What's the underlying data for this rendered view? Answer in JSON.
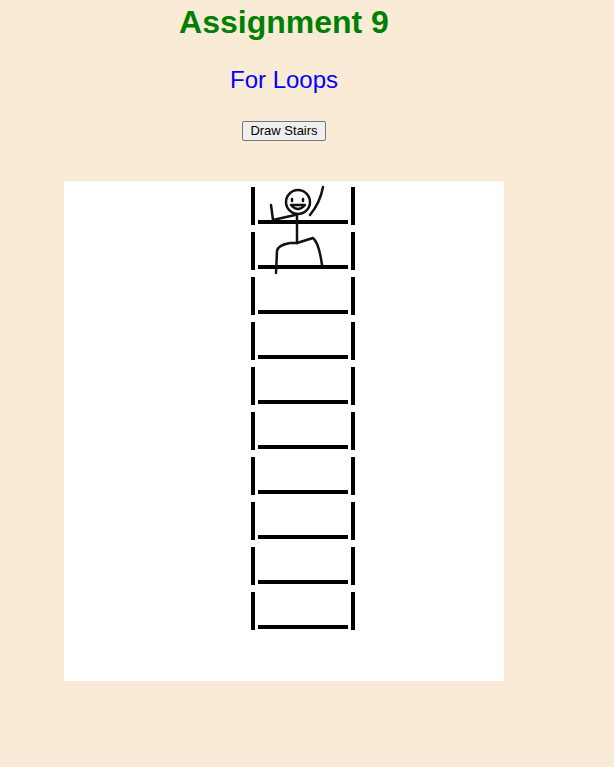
{
  "page": {
    "title": "Assignment 9",
    "subtitle": "For Loops"
  },
  "buttons": [
    {
      "label": "Draw Stairs"
    }
  ],
  "canvas": {
    "steps": 10,
    "figure_on_step": 1
  }
}
